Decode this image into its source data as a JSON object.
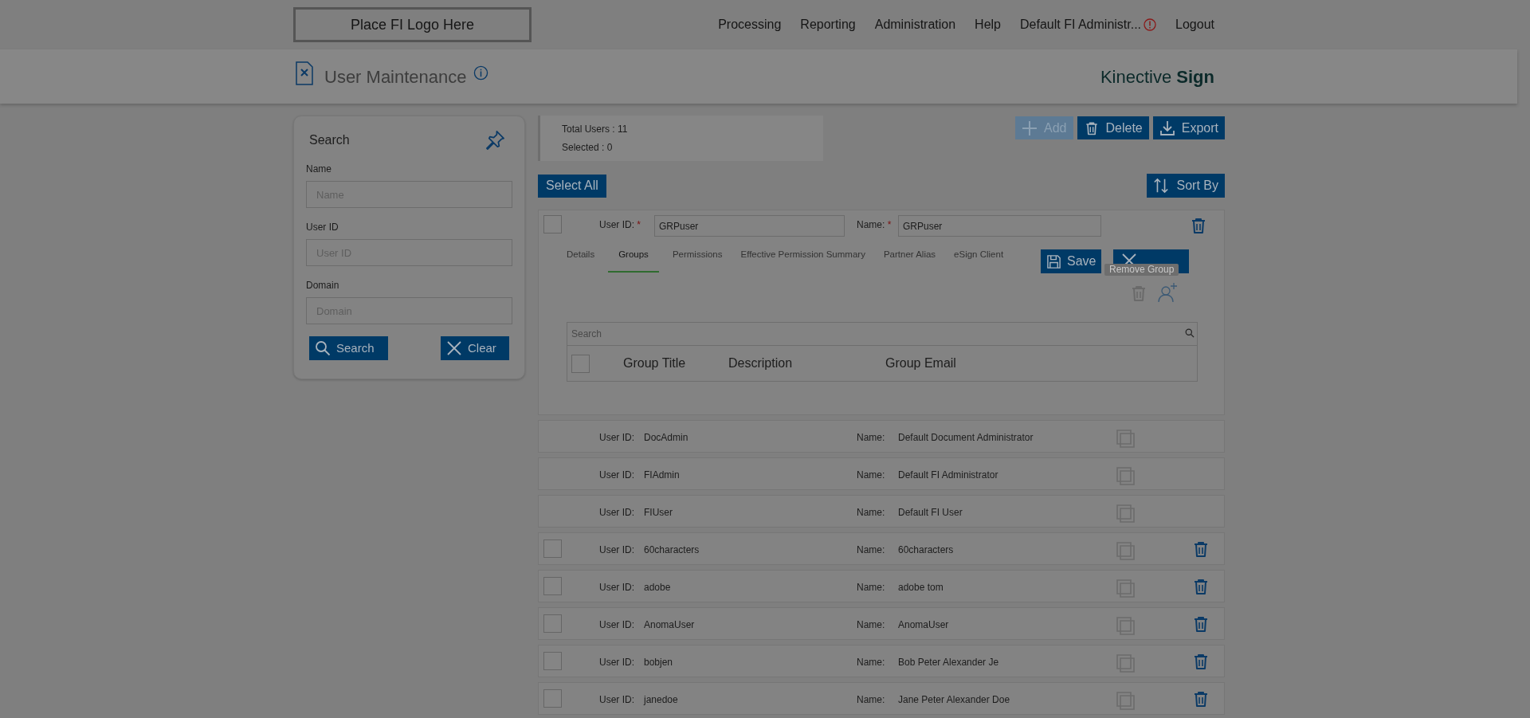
{
  "nav": {
    "logo": "Place FI Logo Here",
    "links": [
      "Processing",
      "Reporting",
      "Administration",
      "Help"
    ],
    "user": "Default FI Administr...",
    "logout": "Logout"
  },
  "page_header": {
    "title": "User Maintenance",
    "brand": "Kinective **Sign**"
  },
  "search_panel": {
    "title": "Search",
    "fields": [
      {
        "label": "Name",
        "placeholder": "Name"
      },
      {
        "label": "User ID",
        "placeholder": "User ID"
      },
      {
        "label": "Domain",
        "placeholder": "Domain"
      }
    ],
    "buttons": [
      {
        "kind": "search",
        "label": "Search"
      },
      {
        "kind": "clear",
        "label": "Clear"
      }
    ]
  },
  "stats": [
    "Total Users : 11",
    "Selected : 0"
  ],
  "actions": [
    {
      "kind": "add",
      "label": "Add",
      "disabled": true
    },
    {
      "kind": "delete",
      "label": "Delete",
      "disabled": false
    },
    {
      "kind": "export",
      "label": "Export",
      "disabled": false
    }
  ],
  "select_all": "Select All",
  "sort_by": "Sort By",
  "expanded_user": {
    "checked": false,
    "user_id_label": "User ID:",
    "user_id": "GRPuser",
    "name_label": "Name:",
    "name": "GRPuser",
    "required_mark": "*",
    "tabs": [
      {
        "label": "Details",
        "selected": false
      },
      {
        "label": "Groups",
        "selected": true
      },
      {
        "label": "Permissions",
        "selected": false
      },
      {
        "label": "Effective Permission Summary",
        "selected": false
      },
      {
        "label": "Partner Alias",
        "selected": false
      },
      {
        "label": "eSign Client",
        "selected": false
      }
    ],
    "save": "Save",
    "tooltip": "Remove Group",
    "groups_table": {
      "search_placeholder": "Search",
      "checked": false,
      "columns": [
        "Group Title",
        "Description",
        "Group Email"
      ]
    }
  },
  "users": [
    {
      "kind": "builtin",
      "user_id_label": "User ID:",
      "user_id": "DocAdmin",
      "name_label": "Name:",
      "name": "Default Document Administrator"
    },
    {
      "kind": "builtin",
      "user_id_label": "User ID:",
      "user_id": "FIAdmin",
      "name_label": "Name:",
      "name": "Default FI Administrator"
    },
    {
      "kind": "builtin",
      "user_id_label": "User ID:",
      "user_id": "FIUser",
      "name_label": "Name:",
      "name": "Default FI User"
    },
    {
      "kind": "custom",
      "checked": false,
      "user_id_label": "User ID:",
      "user_id": "60characters",
      "name_label": "Name:",
      "name": "60characters"
    },
    {
      "kind": "custom",
      "checked": false,
      "user_id_label": "User ID:",
      "user_id": "adobe",
      "name_label": "Name:",
      "name": "adobe tom"
    },
    {
      "kind": "custom",
      "checked": false,
      "user_id_label": "User ID:",
      "user_id": "AnomaUser",
      "name_label": "Name:",
      "name": "AnomaUser"
    },
    {
      "kind": "custom",
      "checked": false,
      "user_id_label": "User ID:",
      "user_id": "bobjen",
      "name_label": "Name:",
      "name": "Bob Peter Alexander Je"
    },
    {
      "kind": "custom",
      "checked": false,
      "user_id_label": "User ID:",
      "user_id": "janedoe",
      "name_label": "Name:",
      "name": "Jane Peter Alexander Doe"
    }
  ]
}
